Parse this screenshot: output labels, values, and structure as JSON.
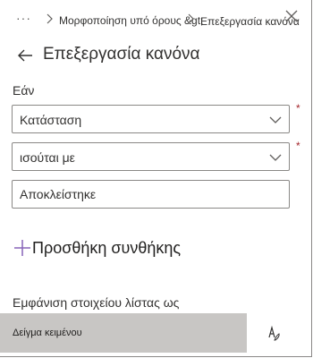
{
  "breadcrumb": {
    "overflow": "···",
    "item1": "Μορφοποίηση υπό όρους &gt;",
    "item2": "Επεξεργασία κανόνα"
  },
  "header": {
    "title": "Επεξεργασία κανόνα"
  },
  "condition": {
    "section_label": "Εάν",
    "field_value": "Κατάσταση",
    "operator_value": "ισούται με",
    "compare_value": "Αποκλείστηκε",
    "required_mark": "*"
  },
  "add_condition": {
    "label": "Προσθήκη συνθήκης"
  },
  "display": {
    "label": "Εμφάνιση στοιχείου λίστας ως",
    "preview_text": "Δείγμα κειμένου"
  },
  "icons": {
    "back": "back-arrow-icon",
    "close": "close-icon",
    "chevron": "chevron-down-icon",
    "plus": "plus-icon",
    "format": "format-brush-icon"
  },
  "colors": {
    "preview_bg": "#c8c6c4",
    "required": "#a4262c",
    "border": "#8a8886"
  }
}
